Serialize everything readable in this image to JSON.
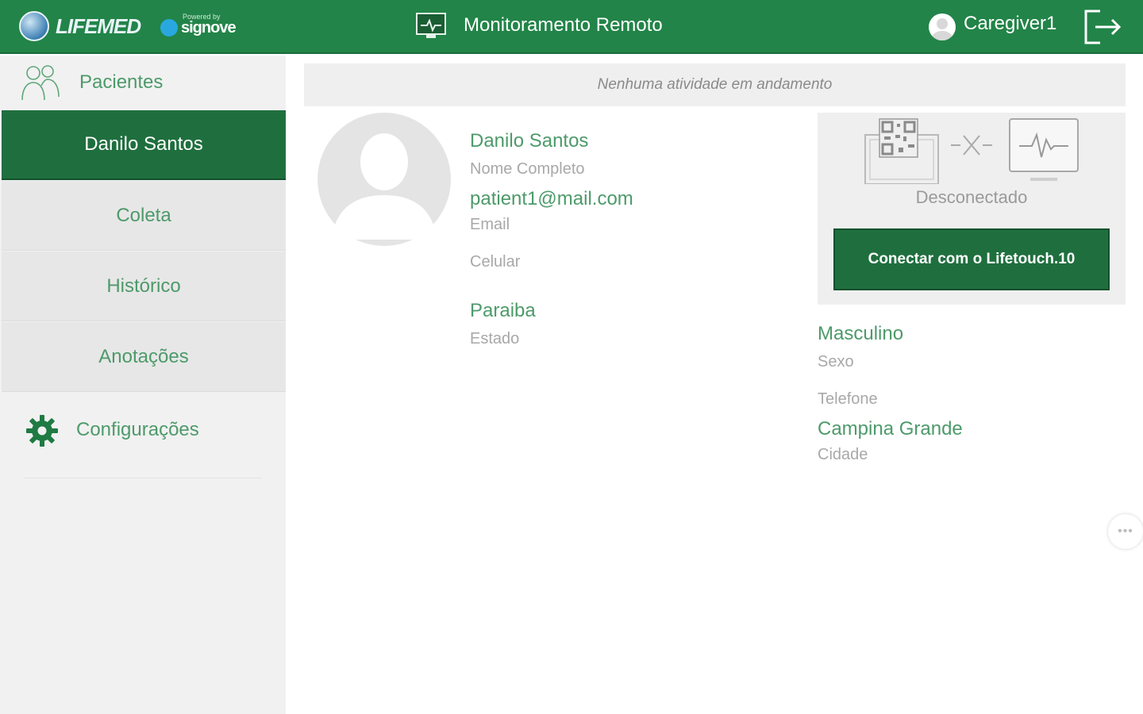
{
  "header": {
    "brand": "LIFEMED",
    "powered_by": "Powered by",
    "partner": "signove",
    "title": "Monitoramento Remoto",
    "username": "Caregiver1"
  },
  "sidebar": {
    "patients_label": "Pacientes",
    "items": [
      {
        "label": "Danilo Santos",
        "active": true
      },
      {
        "label": "Coleta",
        "active": false
      },
      {
        "label": "Histórico",
        "active": false
      },
      {
        "label": "Anotações",
        "active": false
      }
    ],
    "settings_label": "Configurações"
  },
  "activity": {
    "message": "Nenhuma atividade em andamento"
  },
  "patient": {
    "name": "Danilo Santos",
    "name_label": "Nome Completo",
    "email": "patient1@mail.com",
    "email_label": "Email",
    "mobile_label": "Celular",
    "state": "Paraiba",
    "state_label": "Estado",
    "sex": "Masculino",
    "sex_label": "Sexo",
    "phone_label": "Telefone",
    "city": "Campina Grande",
    "city_label": "Cidade"
  },
  "device": {
    "status": "Desconectado",
    "connect_label": "Conectar com o Lifetouch.10"
  },
  "colors": {
    "header_green": "#228448",
    "active_green": "#1f6f3e",
    "text_green": "#4d9a6a"
  }
}
